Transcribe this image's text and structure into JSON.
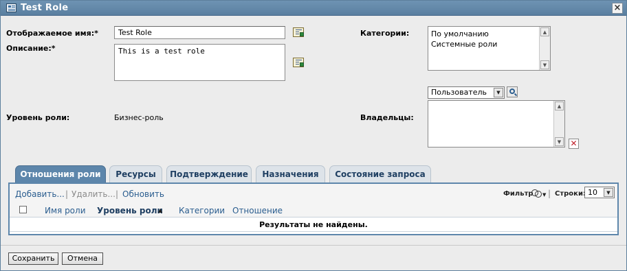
{
  "window": {
    "title": "Test Role"
  },
  "form": {
    "display_name_label": "Отображаемое имя:*",
    "display_name_value": "Test Role",
    "description_label": "Описание:*",
    "description_value": "This is a test role",
    "role_level_label": "Уровень роли:",
    "role_level_value": "Бизнес-роль",
    "categories_label": "Категории:",
    "categories": [
      "По умолчанию",
      "Системные роли"
    ],
    "owners_label": "Владельцы:",
    "owner_type_selected": "Пользователь",
    "owners": []
  },
  "tabs": [
    {
      "label": "Отношения роли",
      "active": true
    },
    {
      "label": "Ресурсы",
      "active": false
    },
    {
      "label": "Подтверждение",
      "active": false
    },
    {
      "label": "Назначения",
      "active": false
    },
    {
      "label": "Состояние запроса",
      "active": false
    }
  ],
  "toolbar": {
    "add_label": "Добавить...",
    "delete_label": "Удалить...",
    "refresh_label": "Обновить",
    "separator": "|",
    "filter_label": "Фильтр",
    "rows_label": "Строки:",
    "rows_value": "10"
  },
  "table": {
    "columns": [
      "Имя роли",
      "Уровень роли",
      "Категории",
      "Отношение"
    ],
    "sorted_column": "Уровень роли",
    "empty_message": "Результаты не найдены."
  },
  "buttons": {
    "save_label": "Сохранить",
    "cancel_label": "Отмена"
  },
  "colors": {
    "titlebar": "#5a7fa0",
    "active_tab": "#5d86ab",
    "link": "#2a5d8f"
  }
}
